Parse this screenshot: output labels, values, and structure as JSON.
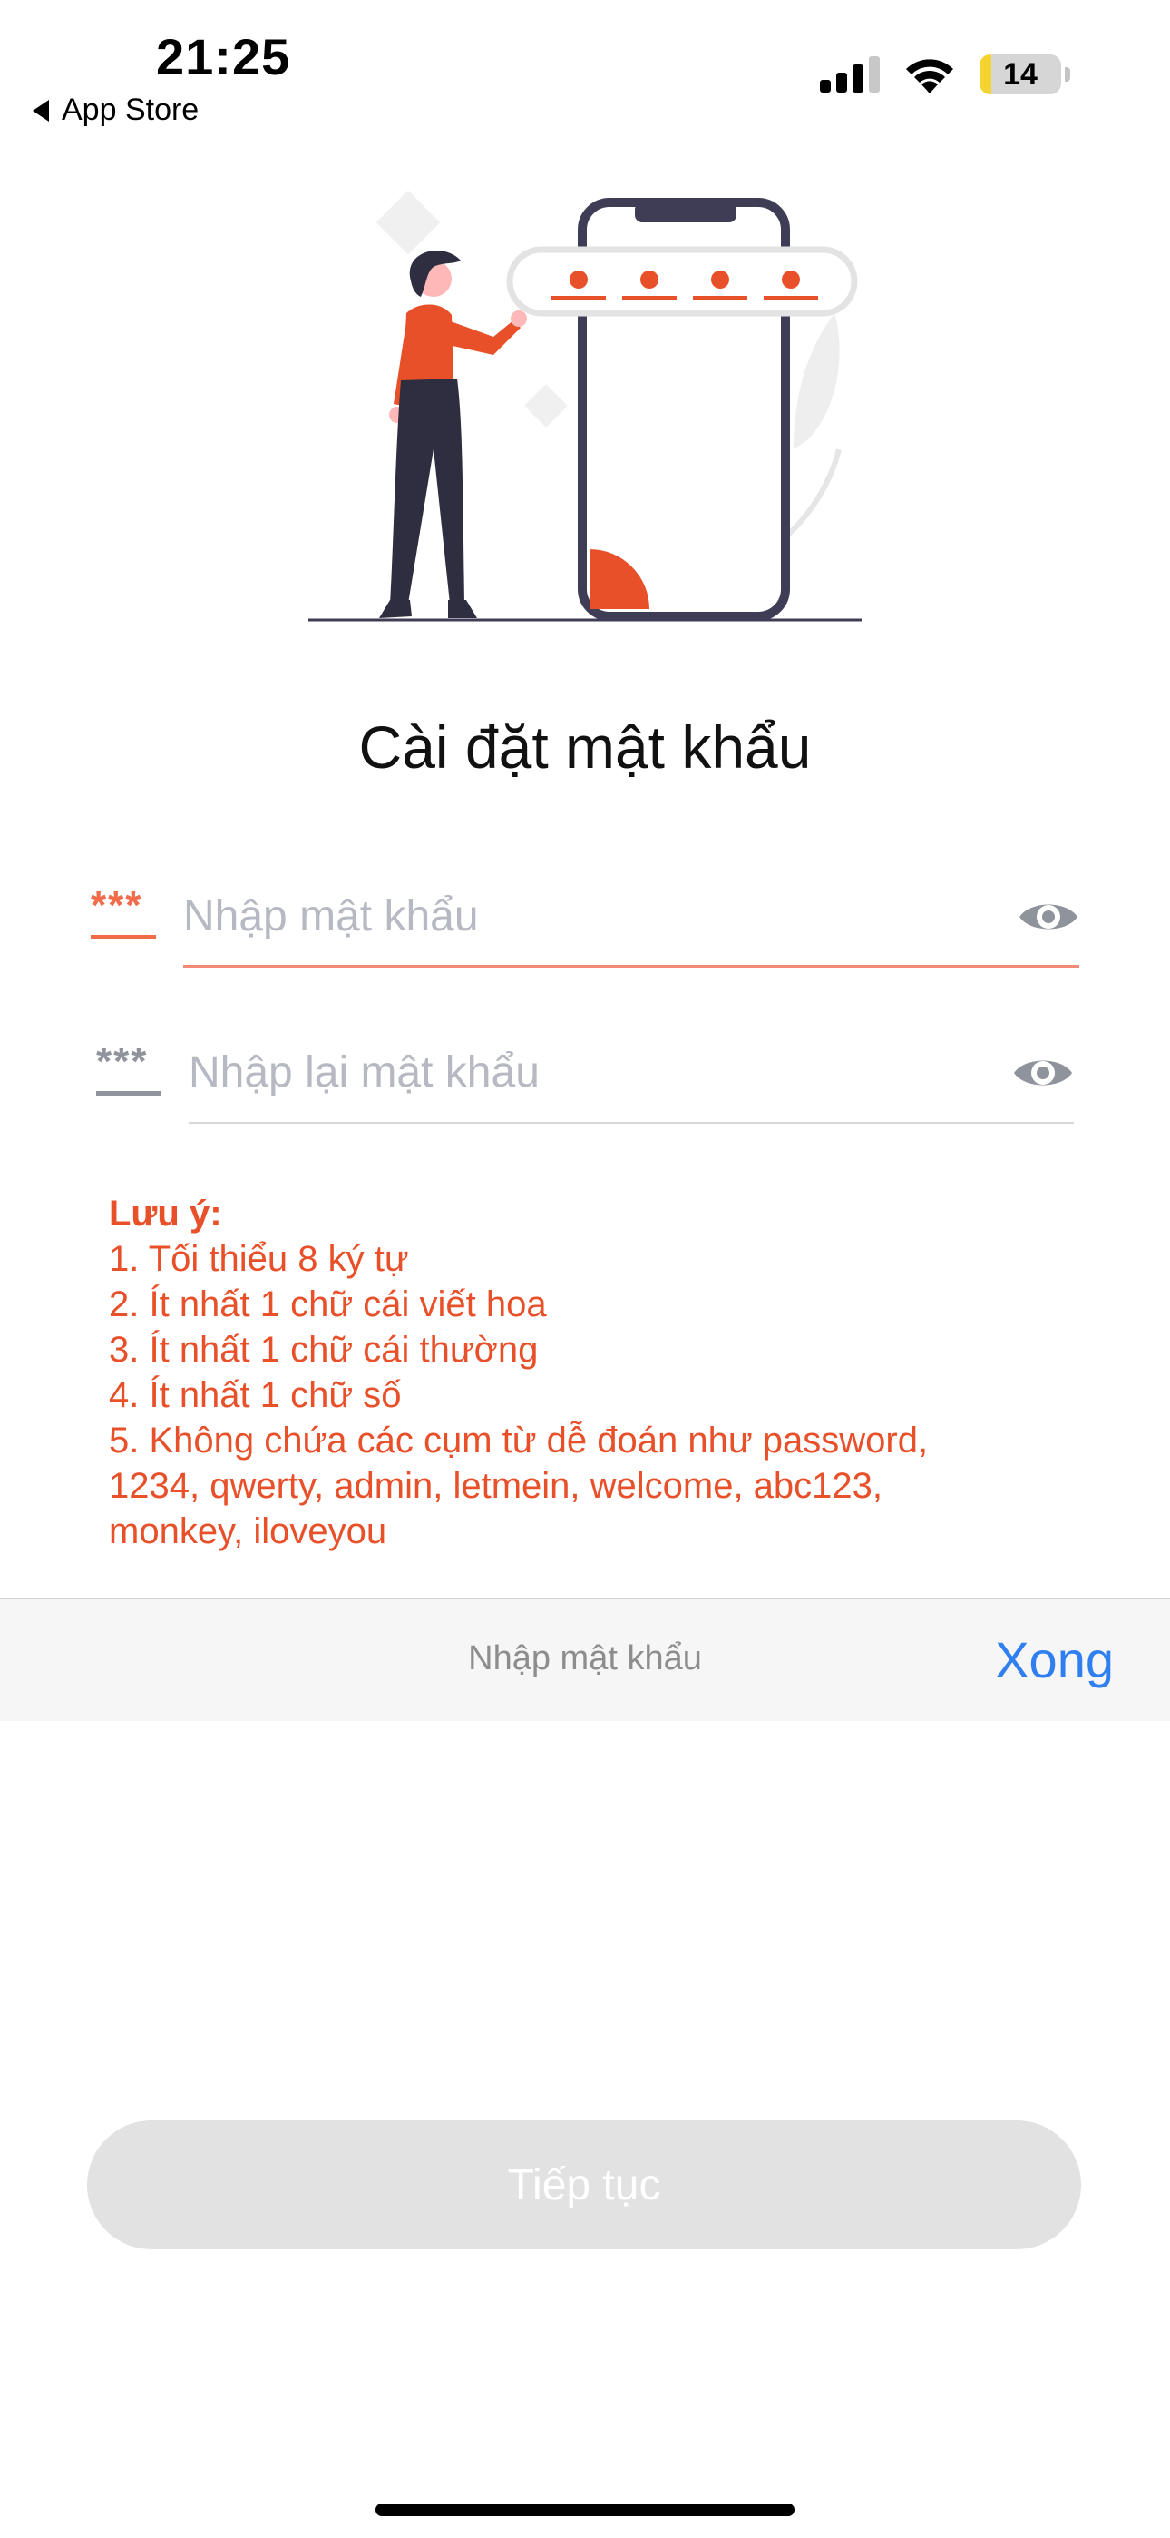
{
  "status_bar": {
    "time": "21:25",
    "back_label": "App Store",
    "battery_level": "14",
    "battery_fraction": 0.14,
    "signal_icon": "cellular-signal-icon",
    "wifi_icon": "wifi-icon"
  },
  "page": {
    "title": "Cài đặt mật khẩu"
  },
  "form": {
    "password": {
      "mask_symbol": "***",
      "placeholder": "Nhập mật khẩu",
      "value": "",
      "icon": "eye-icon"
    },
    "confirm_password": {
      "mask_symbol": "***",
      "placeholder": "Nhập lại mật khẩu",
      "value": "",
      "icon": "eye-icon"
    }
  },
  "notes": {
    "heading": "Lưu ý:",
    "rules": [
      "1. Tối thiểu 8 ký tự",
      "2. Ít nhất 1 chữ cái viết hoa",
      "3. Ít nhất 1 chữ cái thường",
      "4. Ít nhất 1 chữ số",
      "5. Không chứa các cụm từ dễ đoán như password,",
      "1234, qwerty, admin, letmein, welcome, abc123,",
      "monkey, iloveyou"
    ]
  },
  "keyboard_accessory": {
    "label": "Nhập mật khẩu",
    "done_label": "Xong"
  },
  "actions": {
    "continue_label": "Tiếp tục"
  },
  "colors": {
    "accent": "#f06c4a",
    "note_text": "#e8502a",
    "done_blue": "#2f7ff0",
    "disabled_button": "#e2e2e2"
  }
}
